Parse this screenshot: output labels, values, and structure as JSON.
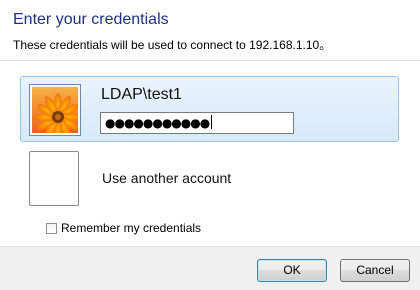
{
  "dialog": {
    "title": "Enter your credentials",
    "subtitle": "These credentials will be used to connect to 192.168.1.10。"
  },
  "accounts": [
    {
      "user_name": "LDAP\\test1",
      "password_value": "●●●●●●●●●●●",
      "tile_icon": "flower-user-tile-icon",
      "selected": true
    },
    {
      "label": "Use another account",
      "tile_icon": "blank-user-tile-icon",
      "selected": false
    }
  ],
  "options": {
    "remember_label": "Remember my credentials",
    "remember_checked": false
  },
  "footer": {
    "ok_label": "OK",
    "cancel_label": "Cancel"
  },
  "colors": {
    "title": "#1e3287",
    "selected_bg": "#dcebfa",
    "selected_border": "#99c6ef",
    "footer_bg": "#f0f0f0"
  }
}
